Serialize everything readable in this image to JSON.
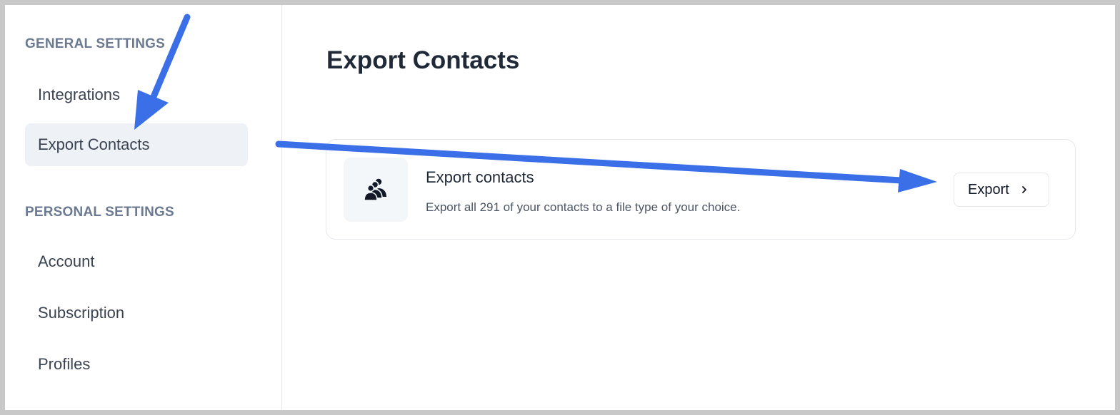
{
  "sidebar": {
    "general_heading": "GENERAL SETTINGS",
    "general_items": [
      {
        "label": "Integrations"
      },
      {
        "label": "Export Contacts",
        "active": true
      }
    ],
    "personal_heading": "PERSONAL SETTINGS",
    "personal_items": [
      {
        "label": "Account"
      },
      {
        "label": "Subscription"
      },
      {
        "label": "Profiles"
      }
    ]
  },
  "main": {
    "title": "Export Contacts",
    "card": {
      "icon": "users-icon",
      "title": "Export contacts",
      "description": "Export all 291 of your contacts to a file type of your choice.",
      "button_label": "Export",
      "button_icon": "chevron-right-icon"
    }
  },
  "annotations": {
    "arrow_color": "#3a6fe8"
  },
  "colors": {
    "active_nav_bg": "#eef2f6",
    "section_heading": "#6b7a90",
    "icon_box_bg": "#f4f7fa"
  }
}
